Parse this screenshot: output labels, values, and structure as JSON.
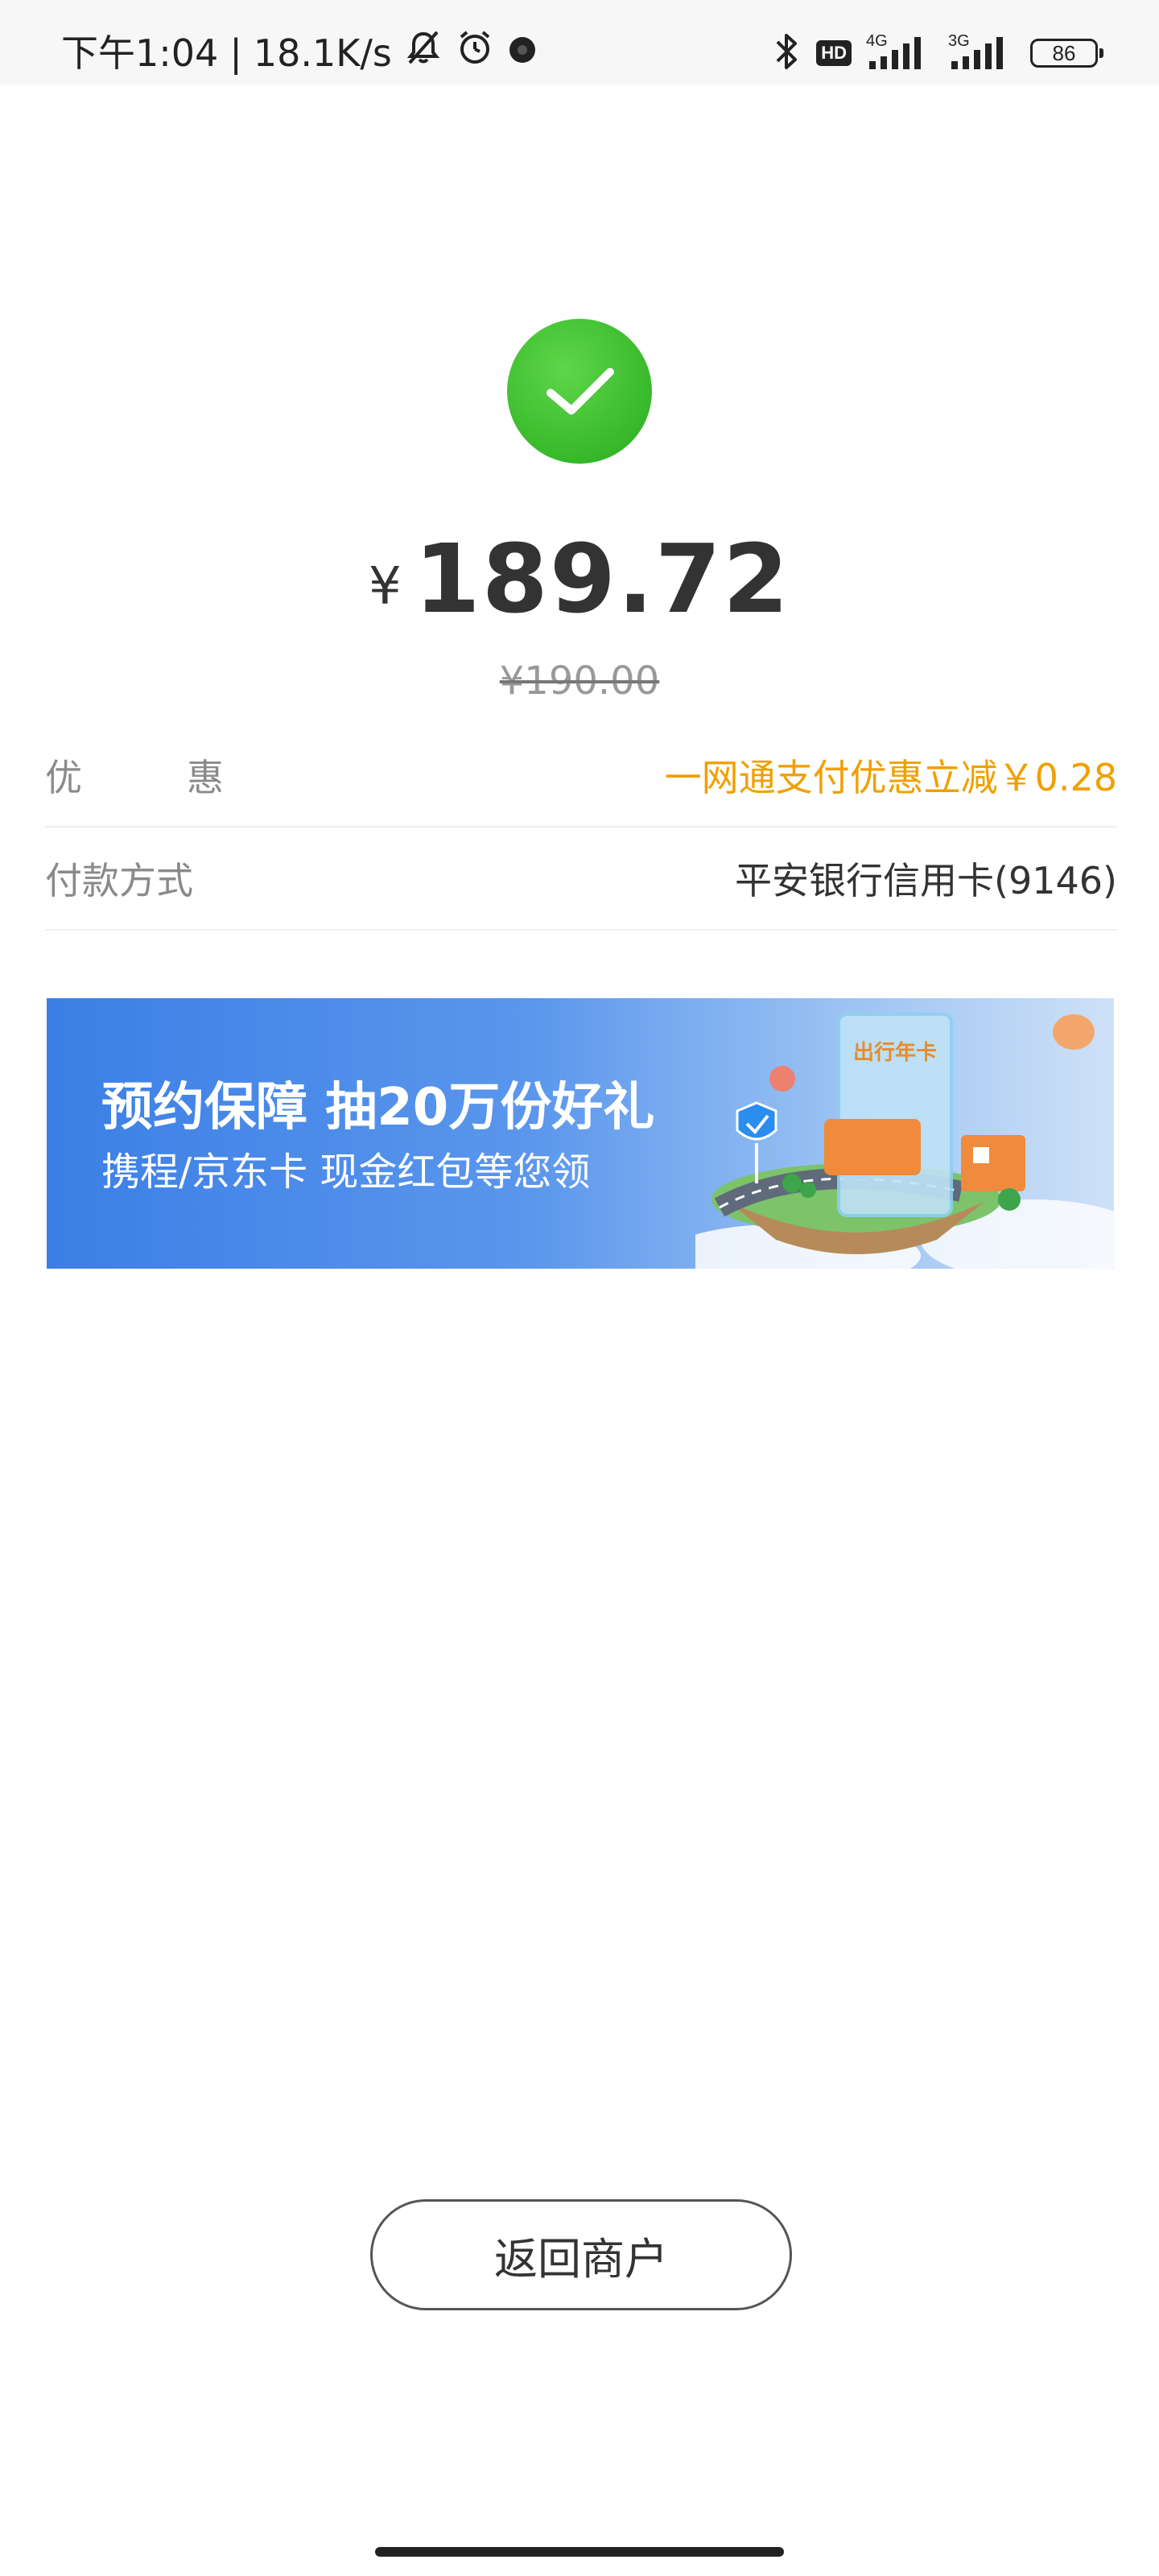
{
  "status_bar": {
    "time": "下午1:04",
    "separator": "|",
    "net_speed": "18.1K/s",
    "hd_label": "HD",
    "signal_1_tag": "4G",
    "signal_2_tag": "3G",
    "battery": "86"
  },
  "payment": {
    "currency_symbol": "¥",
    "amount": "189.72",
    "original_price": "¥190.00"
  },
  "details": [
    {
      "label": "优惠",
      "value": "一网通支付优惠立减￥0.28"
    },
    {
      "label": "付款方式",
      "value": "平安银行信用卡(9146)"
    }
  ],
  "banner": {
    "line1": "预约保障 抽20万份好礼",
    "line2": "携程/京东卡 现金红包等您领",
    "card_text": "出行年卡"
  },
  "actions": {
    "return_label": "返回商户"
  },
  "colors": {
    "success_green": "#37b92a",
    "discount_orange": "#f0a000",
    "banner_blue": "#3b7fe6"
  }
}
